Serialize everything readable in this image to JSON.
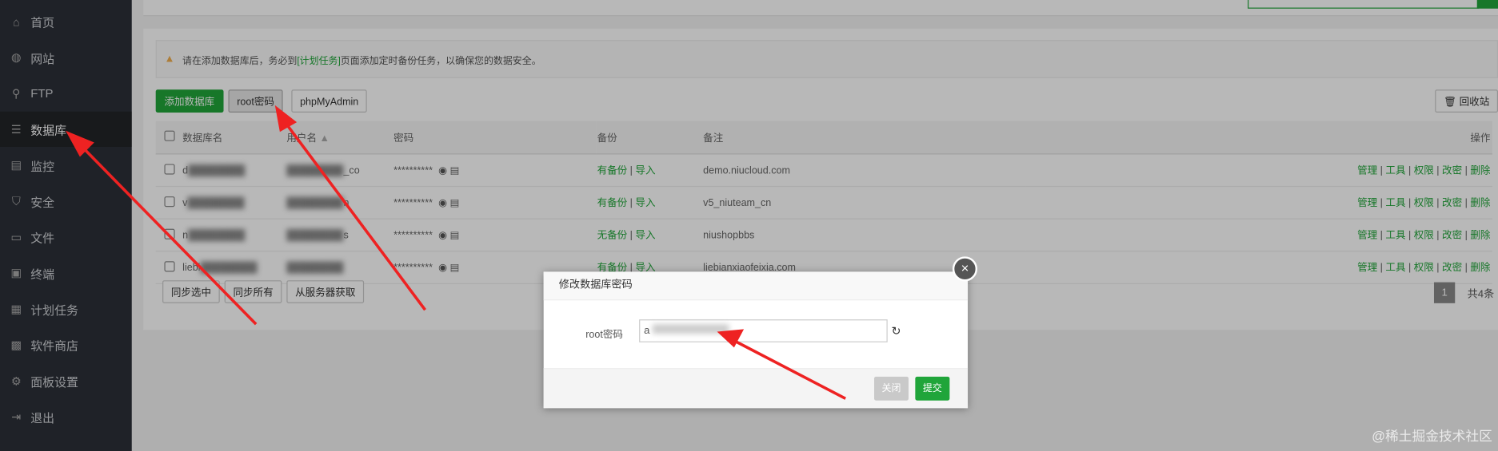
{
  "sidebar": {
    "items": [
      {
        "label": "首页",
        "icon": "home-icon"
      },
      {
        "label": "网站",
        "icon": "globe-icon"
      },
      {
        "label": "FTP",
        "icon": "ftp-icon"
      },
      {
        "label": "数据库",
        "icon": "database-icon"
      },
      {
        "label": "监控",
        "icon": "monitor-icon"
      },
      {
        "label": "安全",
        "icon": "shield-icon"
      },
      {
        "label": "文件",
        "icon": "folder-icon"
      },
      {
        "label": "终端",
        "icon": "terminal-icon"
      },
      {
        "label": "计划任务",
        "icon": "calendar-icon"
      },
      {
        "label": "软件商店",
        "icon": "apps-icon"
      },
      {
        "label": "面板设置",
        "icon": "gear-icon"
      },
      {
        "label": "退出",
        "icon": "logout-icon"
      }
    ]
  },
  "notice": {
    "before": "请在添加数据库后，务必到",
    "link": "[计划任务]",
    "after": "页面添加定时备份任务，以确保您的数据安全。"
  },
  "toolbar": {
    "add": "添加数据库",
    "root": "root密码",
    "pma": "phpMyAdmin",
    "recycle": "回收站"
  },
  "table": {
    "headers": [
      "数据库名",
      "用户名",
      "密码",
      "备份",
      "备注",
      "操作"
    ],
    "rows": [
      {
        "name": "d",
        "user": "_co",
        "password": "**********",
        "backup": "有备份",
        "import": "导入",
        "note": "demo.niucloud.com"
      },
      {
        "name": "v",
        "user": "n",
        "password": "**********",
        "backup": "有备份",
        "import": "导入",
        "note": "v5_niuteam_cn"
      },
      {
        "name": "n",
        "user": "s",
        "password": "**********",
        "backup": "无备份",
        "import": "导入",
        "note": "niushopbbs"
      },
      {
        "name": "liebi",
        "user": "",
        "password": "**********",
        "backup": "有备份",
        "import": "导入",
        "note": "liebianxiaofeixia.com"
      }
    ],
    "actions": [
      "管理",
      "工具",
      "权限",
      "改密",
      "删除"
    ]
  },
  "footer": {
    "sync_selected": "同步选中",
    "sync_all": "同步所有",
    "from_server": "从服务器获取",
    "page": "1",
    "total": "共4条"
  },
  "modal": {
    "title": "修改数据库密码",
    "label": "root密码",
    "value": "a",
    "close": "关闭",
    "submit": "提交"
  },
  "watermark": "@稀土掘金技术社区"
}
